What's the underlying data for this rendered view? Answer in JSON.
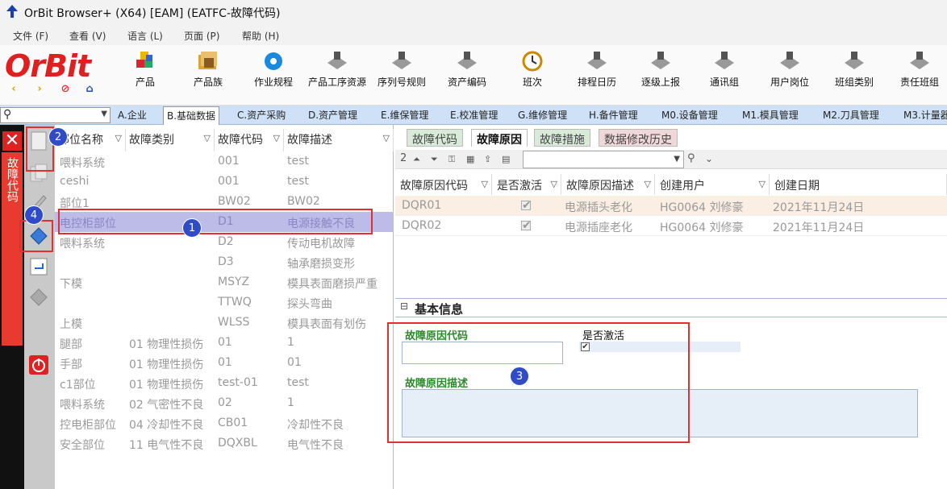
{
  "window": {
    "title": "OrBit Browser+ (X64) [EAM] (EATFC-故障代码)"
  },
  "menu": [
    "文件 (F)",
    "查看 (V)",
    "语言 (L)",
    "页面 (P)",
    "帮助 (H)"
  ],
  "logo": {
    "text": "OrBit"
  },
  "toolbar": [
    "产品",
    "产品族",
    "作业规程",
    "产品工序资源",
    "序列号规则",
    "资产编码",
    "班次",
    "排程日历",
    "逐级上报",
    "通讯组",
    "用户岗位",
    "班组类别",
    "责任班组"
  ],
  "module_tabs": [
    "A.企业",
    "B.基础数据",
    "C.资产采购",
    "D.资产管理",
    "E.维保管理",
    "E.校准管理",
    "G.维修管理",
    "H.备件管理",
    "M0.设备管理",
    "M1.模具管理",
    "M2.刀具管理",
    "M3.计量器"
  ],
  "active_module_tab": "B.基础数据",
  "side_title": "故障代码",
  "left_grid": {
    "columns": [
      "部位名称",
      "故障类别",
      "故障代码",
      "故障描述"
    ],
    "rows": [
      [
        "喂料系统",
        "",
        "001",
        "test"
      ],
      [
        "ceshi",
        "",
        "001",
        "test"
      ],
      [
        "部位1",
        "",
        "BW02",
        "BW02"
      ],
      [
        "电控柜部位",
        "",
        "D1",
        "电源接触不良"
      ],
      [
        "喂料系统",
        "",
        "D2",
        "传动电机故障"
      ],
      [
        "",
        "",
        "D3",
        "轴承磨损变形"
      ],
      [
        "下模",
        "",
        "MSYZ",
        "模具表面磨损严重"
      ],
      [
        "",
        "",
        "TTWQ",
        "探头弯曲"
      ],
      [
        "上模",
        "",
        "WLSS",
        "模具表面有划伤"
      ],
      [
        "腿部",
        "01 物理性损伤",
        "01",
        "1"
      ],
      [
        "手部",
        "01 物理性损伤",
        "01",
        "01"
      ],
      [
        "c1部位",
        "01 物理性损伤",
        "test-01",
        "test"
      ],
      [
        "喂料系统",
        "02 气密性不良",
        "02",
        "1"
      ],
      [
        "控电柜部位",
        "04 冷却性不良",
        "CB01",
        "冷却性不良"
      ],
      [
        "安全部位",
        "11 电气性不良",
        "DQXBL",
        "电气性不良"
      ]
    ],
    "selected_row": 3
  },
  "right_tabs": [
    "故障代码",
    "故障原因",
    "故障措施",
    "数据修改历史"
  ],
  "active_right_tab": "故障原因",
  "subtoolbar": {
    "n1": "2",
    "icons": [
      "sort-asc-icon",
      "sort-desc-icon",
      "lock-icon",
      "grid-icon",
      "export-icon",
      "columns-icon"
    ]
  },
  "right_grid": {
    "columns": [
      "故障原因代码",
      "是否激活",
      "故障原因描述",
      "创建用户",
      "创建日期"
    ],
    "rows": [
      [
        "DQR01",
        "✔",
        "电源插头老化",
        "HG0064 刘修豪",
        "2021年11月24日"
      ],
      [
        "DQR02",
        "✔",
        "电源插座老化",
        "HG0064 刘修豪",
        "2021年11月24日"
      ]
    ]
  },
  "basic_info": {
    "title": "基本信息",
    "code_label": "故障原因代码",
    "active_label": "是否激活",
    "desc_label": "故障原因描述",
    "code_value": "",
    "desc_value": ""
  },
  "badges": [
    "1",
    "2",
    "3",
    "4"
  ],
  "colors": {
    "accent_red": "#e03030",
    "badge_blue": "#2f4bc8",
    "tab_bar": "#cfe1f6",
    "side_red": "#e83a2e"
  }
}
